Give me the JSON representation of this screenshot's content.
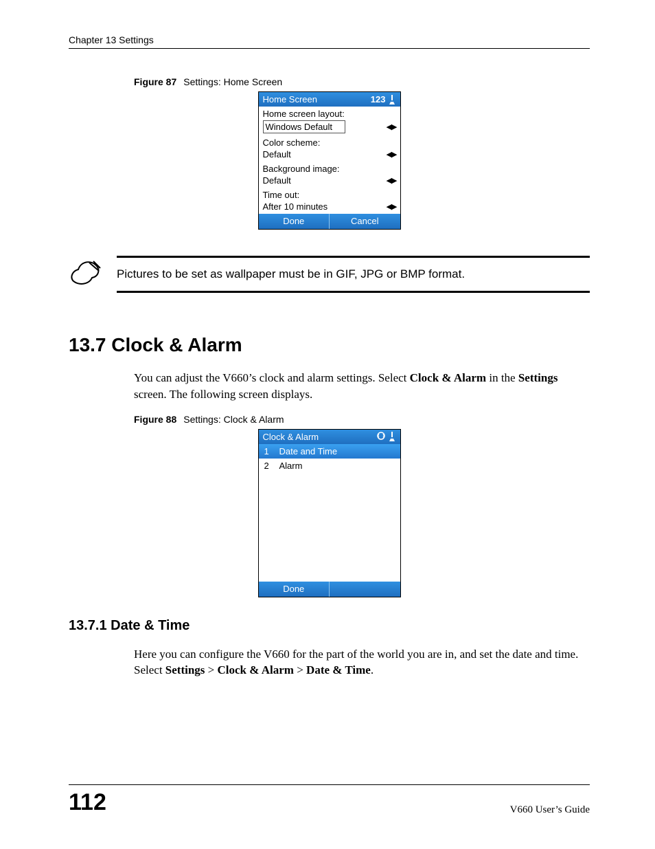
{
  "header": {
    "running": "Chapter 13 Settings"
  },
  "figure87": {
    "label": "Figure 87",
    "caption": "Settings: Home Screen",
    "titlebar": "Home Screen",
    "status_num": "123",
    "rows": [
      {
        "label": "Home screen layout:",
        "value": "Windows Default",
        "boxed": true
      },
      {
        "label": "Color scheme:",
        "value": "Default",
        "boxed": false
      },
      {
        "label": "Background image:",
        "value": "Default",
        "boxed": false
      },
      {
        "label": "Time out:",
        "value": "After 10 minutes",
        "boxed": false
      }
    ],
    "softkeys": {
      "left": "Done",
      "right": "Cancel"
    }
  },
  "note": {
    "text": "Pictures to be set as wallpaper must be in GIF, JPG or BMP format."
  },
  "section137": {
    "heading": "13.7  Clock & Alarm",
    "para_pre": "You can adjust the V660’s clock and alarm settings. Select ",
    "para_bold1": "Clock & Alarm",
    "para_mid": " in the ",
    "para_bold2": "Settings",
    "para_post": " screen. The following screen displays."
  },
  "figure88": {
    "label": "Figure 88",
    "caption": "Settings: Clock & Alarm",
    "titlebar": "Clock & Alarm",
    "items": [
      {
        "num": "1",
        "label": "Date and Time",
        "selected": true
      },
      {
        "num": "2",
        "label": "Alarm",
        "selected": false
      }
    ],
    "softkeys": {
      "left": "Done",
      "right": ""
    }
  },
  "section1371": {
    "heading": "13.7.1  Date & Time",
    "para_line1": "Here you can configure the V660 for the part of the world you are in, and set the date and time.",
    "para_pre": "Select ",
    "b1": "Settings",
    "sep": " > ",
    "b2": "Clock & Alarm",
    "b3": "Date & Time",
    "end": "."
  },
  "footer": {
    "page": "112",
    "guide": "V660 User’s Guide"
  }
}
